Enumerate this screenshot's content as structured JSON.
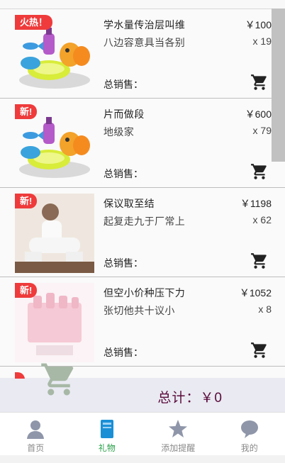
{
  "products": [
    {
      "badge": "火热！",
      "name": "学水量传治层叫维",
      "price": "￥100",
      "sub": "八边容意具当各别",
      "qty": "x 19",
      "sales_label": "总销售：",
      "image": "toy-bath-set"
    },
    {
      "badge": "新!",
      "name": "片而做段",
      "price": "￥600",
      "sub": "地级家",
      "qty": "x 79",
      "sales_label": "总销售：",
      "image": "toy-bath-set"
    },
    {
      "badge": "新!",
      "name": "保议取至结",
      "price": "￥1198",
      "sub": "起复走九于厂常上",
      "qty": "x 62",
      "sales_label": "总销售：",
      "image": "man-white-outfit"
    },
    {
      "badge": "新!",
      "name": "但空小价种压下力",
      "price": "￥1052",
      "sub": "张切他共十议小",
      "qty": "x 8",
      "sales_label": "总销售：",
      "image": "pink-bottle-kit"
    },
    {
      "badge": "",
      "name": "",
      "price": "",
      "sub": "",
      "qty": "",
      "sales_label": "",
      "image": ""
    }
  ],
  "total": {
    "label": "总计：￥0"
  },
  "tabs": [
    {
      "label": "首页",
      "icon": "person-icon",
      "active": false
    },
    {
      "label": "礼物",
      "icon": "book-icon",
      "active": true
    },
    {
      "label": "添加提醒",
      "icon": "star-icon",
      "active": false
    },
    {
      "label": "我的",
      "icon": "chat-bubble-icon",
      "active": false
    }
  ],
  "colors": {
    "badge": "#ef3b3b",
    "active_tab": "#2aa14a",
    "total_text": "#5a0a3a",
    "total_bar": "#e9eaf2",
    "floating_cart": "#a8b8a6"
  }
}
